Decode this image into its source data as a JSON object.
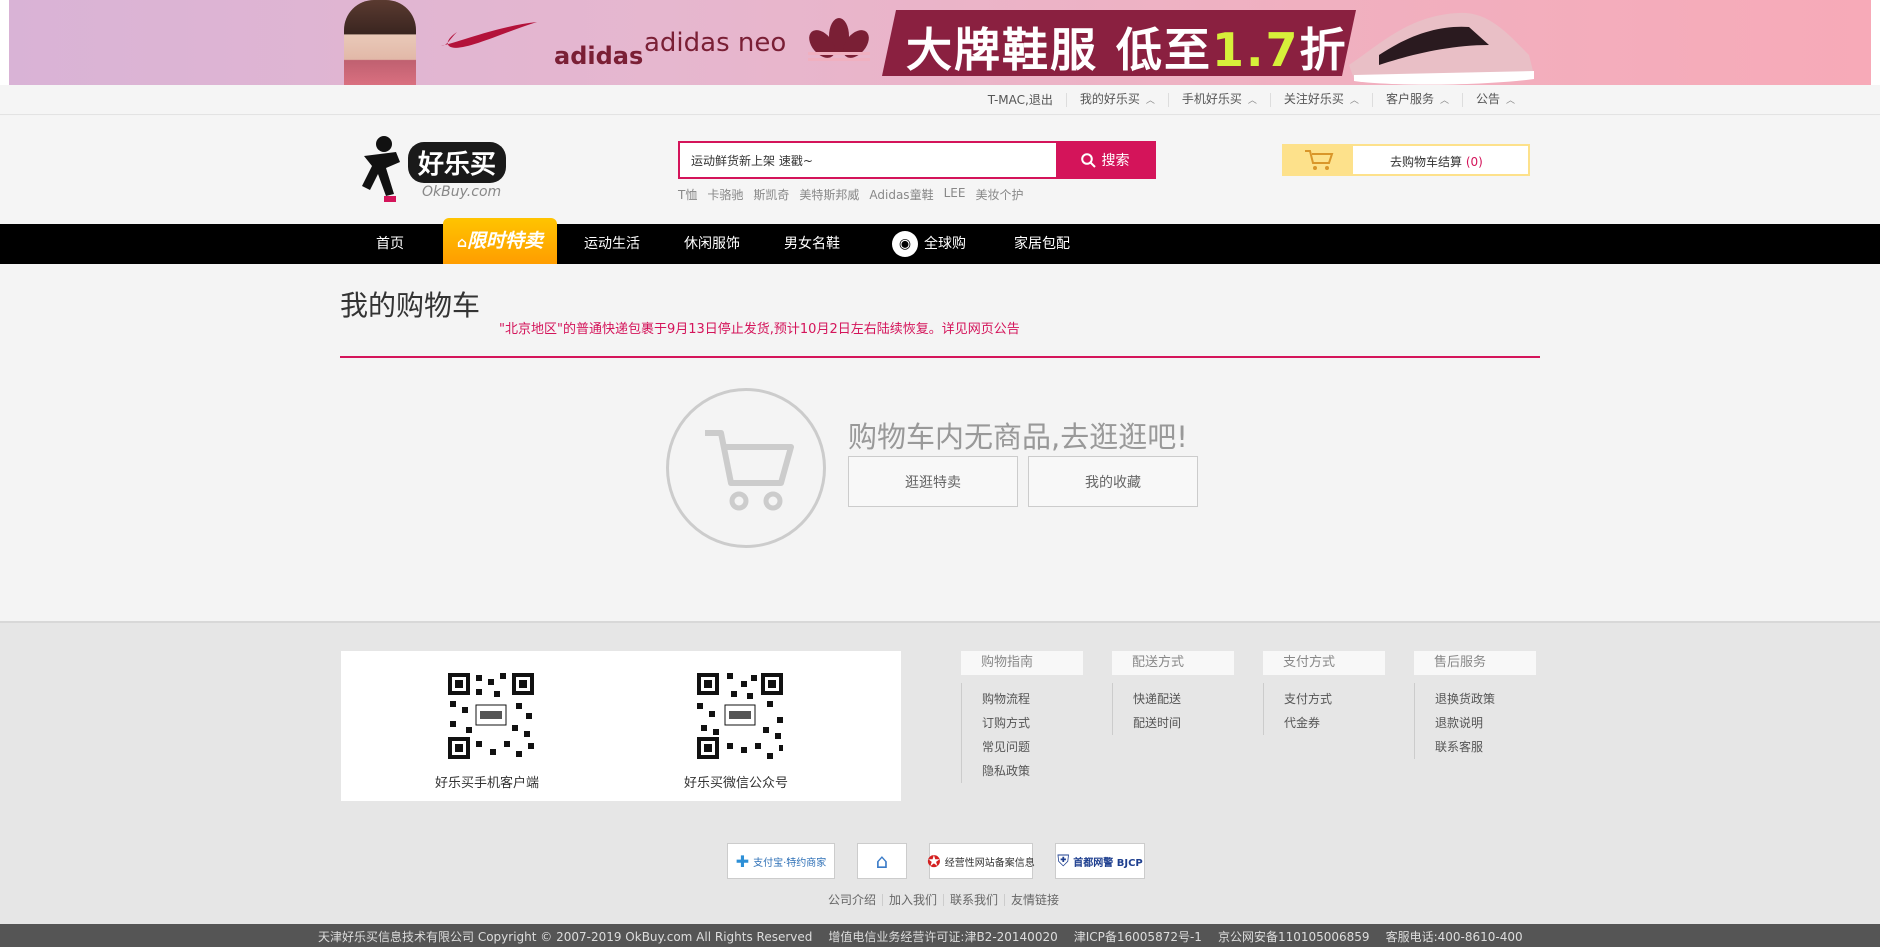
{
  "banner": {
    "brands": [
      "adidas",
      "adidas neo"
    ],
    "promo": "大牌鞋服 低至",
    "promo_num": "1.7",
    "promo_suffix": "折"
  },
  "topbar": {
    "user": "T-MAC,退出",
    "links": [
      "我的好乐买",
      "手机好乐买",
      "关注好乐买",
      "客户服务",
      "公告"
    ]
  },
  "logo": {
    "cn": "好乐买",
    "en": "OkBuy.com"
  },
  "search": {
    "placeholder": "运动鲜货新上架 速戳~",
    "button": "搜索",
    "hotwords": [
      "T恤",
      "卡骆驰",
      "斯凯奇",
      "美特斯邦威",
      "Adidas童鞋",
      "LEE",
      "美妆个护"
    ]
  },
  "cart": {
    "label": "去购物车结算",
    "count": "(0)"
  },
  "nav": {
    "home": "首页",
    "sale": "限时特卖",
    "sports": "运动生活",
    "casual": "休闲服饰",
    "shoes": "男女名鞋",
    "global": "全球购",
    "home_living": "家居包配"
  },
  "main": {
    "title": "我的购物车",
    "notice": "\"北京地区\"的普通快递包裹于9月13日停止发货,预计10月2日左右陆续恢复。详见网页公告",
    "empty_text": "购物车内无商品,去逛逛吧!",
    "btn_browse": "逛逛特卖",
    "btn_favorites": "我的收藏"
  },
  "footer": {
    "qr_app": "好乐买手机客户端",
    "qr_wechat": "好乐买微信公众号",
    "columns": [
      {
        "title": "购物指南",
        "items": [
          "购物流程",
          "订购方式",
          "常见问题",
          "隐私政策"
        ]
      },
      {
        "title": "配送方式",
        "items": [
          "快递配送",
          "配送时间"
        ]
      },
      {
        "title": "支付方式",
        "items": [
          "支付方式",
          "代金券"
        ]
      },
      {
        "title": "售后服务",
        "items": [
          "退换货政策",
          "退款说明",
          "联系客服"
        ]
      }
    ],
    "badges": [
      "支付宝·特约商家",
      "经营性网站备案信息",
      "首都网警 BJCP"
    ],
    "links": [
      "公司介绍",
      "加入我们",
      "联系我们",
      "友情链接"
    ]
  },
  "bottom": {
    "company": "天津好乐买信息技术有限公司 Copyright © 2007-2019 OkBuy.com All Rights Reserved",
    "license": "增值电信业务经营许可证:津B2-20140020",
    "icp": "津ICP备16005872号-1",
    "police": "京公网安备110105006859",
    "phone": "客服电话:400-8610-400"
  },
  "colors": {
    "accent": "#d4145a",
    "nav_bg": "#000000",
    "sale": "#ffb000"
  }
}
